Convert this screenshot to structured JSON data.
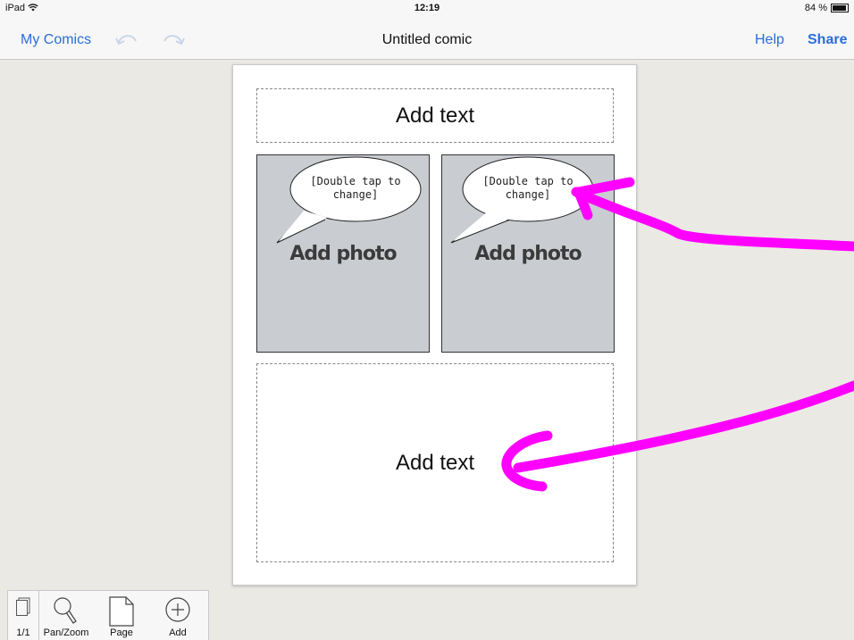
{
  "status_bar": {
    "carrier": "iPad",
    "time": "12:19",
    "battery": "84 %",
    "battery_level": 0.84
  },
  "nav": {
    "back_label": "My Comics",
    "title": "Untitled comic",
    "help_label": "Help",
    "share_label": "Share"
  },
  "comic": {
    "top_text": "Add text",
    "panels": [
      {
        "bubble_line1": "[Double tap to",
        "bubble_line2": "change]",
        "photo_label": "Add photo"
      },
      {
        "bubble_line1": "[Double tap to",
        "bubble_line2": "change]",
        "photo_label": "Add photo"
      }
    ],
    "bottom_text": "Add text"
  },
  "toolbar": {
    "page_count": "1/1",
    "pan_zoom_label": "Pan/Zoom",
    "page_label": "Page",
    "add_label": "Add"
  },
  "colors": {
    "accent": "#2a6ed8",
    "annotation": "#ff00ff",
    "photo_bg": "#c9ccd0",
    "canvas_bg": "#ebe9e4"
  },
  "icons": [
    "wifi-icon",
    "battery-icon",
    "undo-icon",
    "redo-icon",
    "pages-icon",
    "magnifier-icon",
    "page-icon",
    "plus-circle-icon"
  ]
}
